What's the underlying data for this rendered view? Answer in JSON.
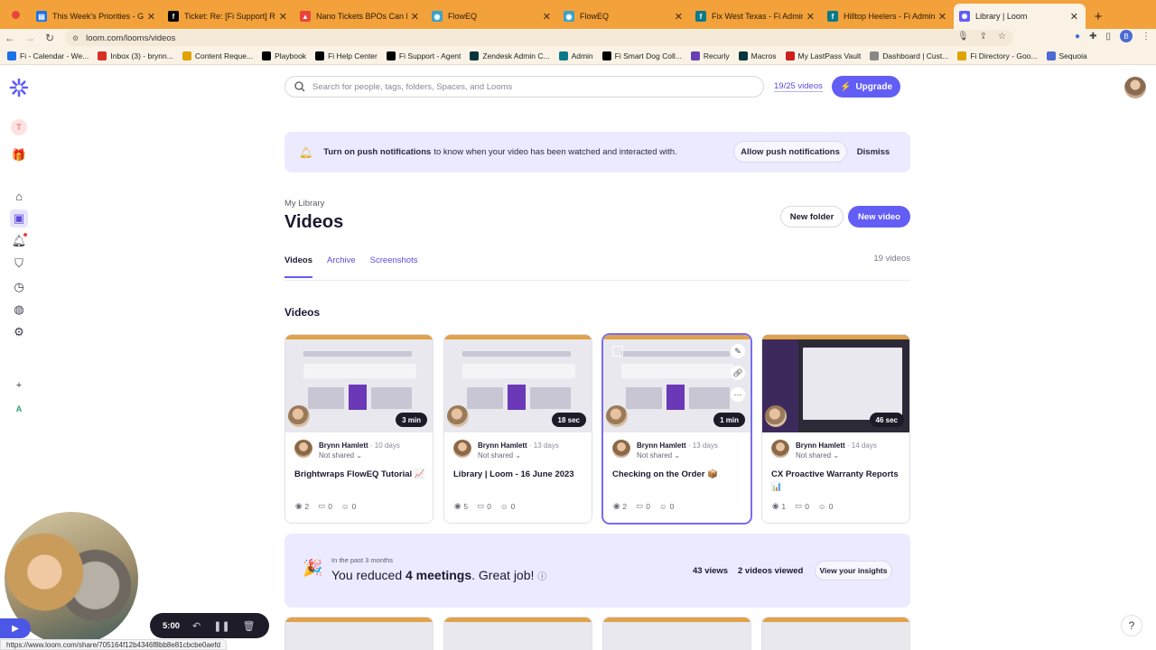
{
  "browser": {
    "tabs": [
      {
        "title": "This Week's Priorities - Go",
        "fav_color": "#1a73e8",
        "fav_glyph": "▤"
      },
      {
        "title": "Ticket: Re: [Fi Support] Re",
        "fav_color": "#000000",
        "fav_glyph": "f"
      },
      {
        "title": "Nano Tickets BPOs Can Ha",
        "fav_color": "#e8453c",
        "fav_glyph": "▲"
      },
      {
        "title": "FlowEQ",
        "fav_color": "#3aa3c9",
        "fav_glyph": "◉"
      },
      {
        "title": "FlowEQ",
        "fav_color": "#3aa3c9",
        "fav_glyph": "◉"
      },
      {
        "title": "Fix West Texas - Fi Admin",
        "fav_color": "#0a7a8a",
        "fav_glyph": "f"
      },
      {
        "title": "Hilltop Heelers - Fi Admin",
        "fav_color": "#0a7a8a",
        "fav_glyph": "f"
      },
      {
        "title": "Library | Loom",
        "fav_color": "#625df5",
        "fav_glyph": "✺",
        "active": true
      }
    ],
    "url": "loom.com/looms/videos",
    "profile_initial": "B",
    "bookmarks": [
      {
        "label": "Fi - Calendar - We...",
        "color": "#1a73e8"
      },
      {
        "label": "Inbox (3) - brynn...",
        "color": "#d93025"
      },
      {
        "label": "Content Reque...",
        "color": "#e0a400"
      },
      {
        "label": "Playbook",
        "color": "#000000"
      },
      {
        "label": "Fi Help Center",
        "color": "#000000"
      },
      {
        "label": "Fi Support - Agent",
        "color": "#000000"
      },
      {
        "label": "Zendesk Admin C...",
        "color": "#03363d"
      },
      {
        "label": "Admin",
        "color": "#0a7a8a"
      },
      {
        "label": "Fi Smart Dog Coll...",
        "color": "#000000"
      },
      {
        "label": "Recurly",
        "color": "#6a3fb5"
      },
      {
        "label": "Macros",
        "color": "#03363d"
      },
      {
        "label": "My LastPass Vault",
        "color": "#cc1f1f"
      },
      {
        "label": "Dashboard | Cust...",
        "color": "#888888"
      },
      {
        "label": "Fi Directory - Goo...",
        "color": "#e0a400"
      },
      {
        "label": "Sequoia",
        "color": "#4a6cd4"
      }
    ]
  },
  "loom": {
    "search_placeholder": "Search for people, tags, folders, Spaces, and Looms",
    "video_quota": "19/25 videos",
    "upgrade_label": "Upgrade",
    "banner": {
      "bold": "Turn on push notifications",
      "text": "to know when your video has been watched and interacted with.",
      "allow": "Allow push notifications",
      "dismiss": "Dismiss"
    },
    "breadcrumb": "My Library",
    "page_title": "Videos",
    "new_folder": "New folder",
    "new_video": "New video",
    "tabs": [
      "Videos",
      "Archive",
      "Screenshots"
    ],
    "total_count": "19 videos",
    "section_title": "Videos",
    "rail_badge_initial": "T",
    "rail_bottom_initial": "A",
    "videos": [
      {
        "duration": "3 min",
        "author": "Brynn Hamlett",
        "ago": "· 10 days",
        "sharing": "Not shared",
        "title": "Brightwraps FlowEQ Tutorial 📈",
        "views": "2",
        "comments": "0",
        "reactions": "0"
      },
      {
        "duration": "18 sec",
        "author": "Brynn Hamlett",
        "ago": "· 13 days",
        "sharing": "Not shared",
        "title": "Library | Loom - 16 June 2023",
        "views": "5",
        "comments": "0",
        "reactions": "0"
      },
      {
        "duration": "1 min",
        "author": "Brynn Hamlett",
        "ago": "· 13 days",
        "sharing": "Not shared",
        "title": "Checking on the Order 📦",
        "views": "2",
        "comments": "0",
        "reactions": "0"
      },
      {
        "duration": "46 sec",
        "author": "Brynn Hamlett",
        "ago": "· 14 days",
        "sharing": "Not shared",
        "title": "CX Proactive Warranty Reports 📊",
        "views": "1",
        "comments": "0",
        "reactions": "0"
      }
    ],
    "insights": {
      "period": "In the past 3 months",
      "msg_pre": "You reduced",
      "msg_bold": "4 meetings",
      "msg_post": ". Great job!",
      "views": "43 views",
      "viewed": "2 videos viewed",
      "button": "View your insights"
    },
    "recorder": {
      "time": "5:00"
    },
    "help": "?"
  },
  "status_url": "https://www.loom.com/share/705164f12b4346f8bb8e81cbcbe0aefd"
}
